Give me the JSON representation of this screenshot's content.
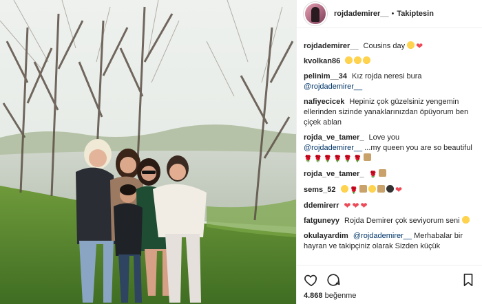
{
  "post": {
    "username": "rojdademirer__",
    "separator": "•",
    "follow_status": "Takiptesin"
  },
  "comments": [
    {
      "user": "rojdademirer__",
      "text": "Cousins day",
      "emojis": [
        "victory-hand",
        "heart"
      ]
    },
    {
      "user": "kvolkan86",
      "text": "",
      "emojis": [
        "heart-eyes",
        "heart-eyes",
        "heart-eyes"
      ]
    },
    {
      "user": "pelinim__34",
      "text": "Kız rojda neresi bura",
      "mention": "@rojdademirer__"
    },
    {
      "user": "nafiyecicek",
      "text": "Hepiniz çok güzelsiniz yengemin ellerinden sizinde yanaklarınızdan öpüyorum ben çiçek ablan"
    },
    {
      "user": "rojda_ve_tamer_",
      "text": "Love you",
      "mention": "@rojdademirer__",
      "text2": "...my queen you are so beautiful",
      "emojis": [
        "rose",
        "rose",
        "rose",
        "rose",
        "rose",
        "rose",
        "bouquet"
      ]
    },
    {
      "user": "rojda_ve_tamer_",
      "text": "",
      "emojis": [
        "rose",
        "bouquet"
      ]
    },
    {
      "user": "sems_52",
      "text": "",
      "emojis": [
        "heart-eyes",
        "rose",
        "flower",
        "face",
        "thumbs",
        "dark",
        "heart"
      ]
    },
    {
      "user": "ddemirerr",
      "text": "",
      "emojis": [
        "heart",
        "heart",
        "heart"
      ]
    },
    {
      "user": "fatguneyy",
      "text": "Rojda Demirer çok seviyorum seni",
      "emojis": [
        "smile"
      ]
    },
    {
      "user": "okulayardim",
      "mention": "@rojdademirer__",
      "text": "Merhabalar bir hayran ve takipçiniz olarak Sizden küçük"
    }
  ],
  "actions": {
    "like_icon": "heart-outline-icon",
    "comment_icon": "comment-bubble-icon",
    "save_icon": "bookmark-icon"
  },
  "likes": {
    "count": "4.868",
    "label": "beğenme"
  },
  "colors": {
    "link": "#003569",
    "heart": "#ed4956",
    "border": "#efefef"
  }
}
